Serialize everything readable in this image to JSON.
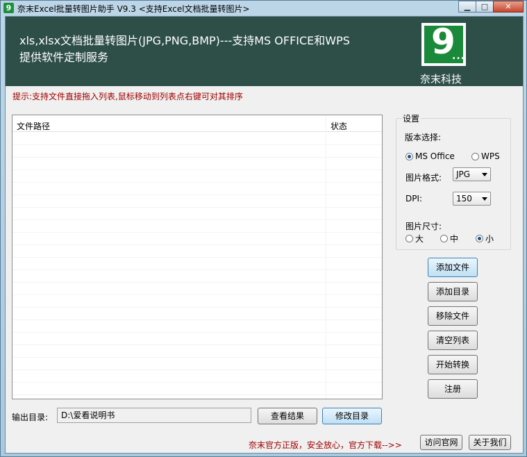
{
  "window": {
    "title": "奈末Excel批量转图片助手 V9.3 <支持Excel文档批量转图片>",
    "app_icon": "9",
    "min_glyph": "▁",
    "max_glyph": "□",
    "close_glyph": "✕"
  },
  "banner": {
    "line1": "xls,xlsx文档批量转图片(JPG,PNG,BMP)---支持MS OFFICE和WPS",
    "line2": "提供软件定制服务",
    "logo_digit": "9",
    "logo_dots": "...",
    "logo_text": "奈末科技"
  },
  "hint": "提示:支持文件直接拖入列表,鼠标移动到列表点右键可对其排序",
  "file_list": {
    "col_path": "文件路径",
    "col_status": "状态",
    "rows": []
  },
  "settings": {
    "legend": "设置",
    "version_label": "版本选择:",
    "version_options": [
      "MS Office",
      "WPS"
    ],
    "version_selected": "MS Office",
    "format_label": "图片格式:",
    "format_value": "JPG",
    "dpi_label": "DPI:",
    "dpi_value": "150",
    "size_label": "图片尺寸:",
    "size_options": [
      "大",
      "中",
      "小"
    ],
    "size_selected": "小"
  },
  "buttons": {
    "add_file": "添加文件",
    "add_dir": "添加目录",
    "remove_file": "移除文件",
    "clear_list": "清空列表",
    "start": "开始转换",
    "register": "注册",
    "view_result": "查看结果",
    "change_dir": "修改目录",
    "visit_site": "访问官网",
    "about": "关于我们"
  },
  "output": {
    "label": "输出目录:",
    "value": "D:\\爱看说明书"
  },
  "promo": "奈末官方正版，安全放心，官方下载-->>"
}
